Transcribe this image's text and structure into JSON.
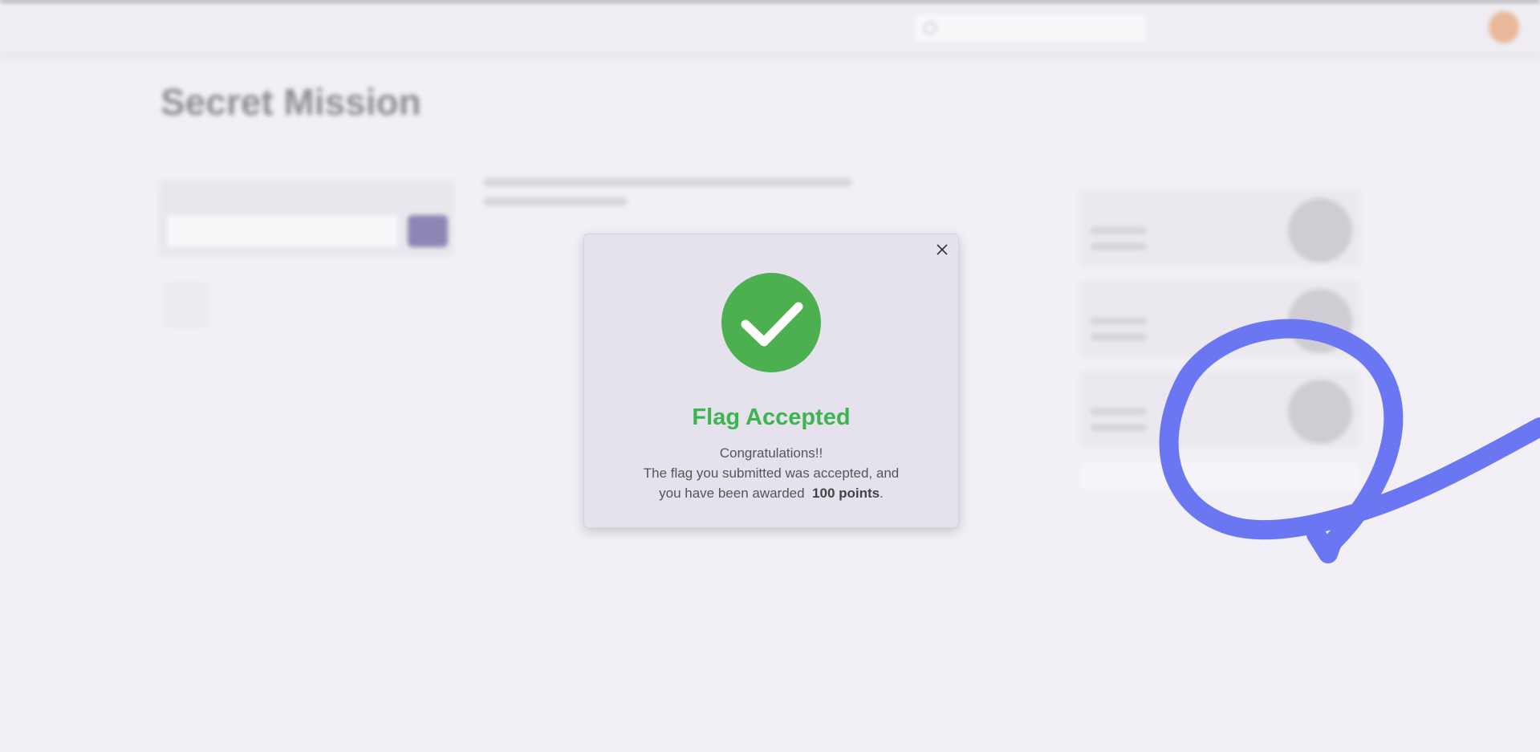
{
  "modal": {
    "title": "Flag Accepted",
    "line1": "Congratulations!!",
    "line2": "The flag you submitted was accepted, and",
    "line3_prefix": "you have been awarded",
    "points": "100 points",
    "line3_suffix": ".",
    "check_icon": "check-circle-icon",
    "close_icon": "close-icon",
    "success_color": "#4caf50"
  },
  "background": {
    "page_title": "Secret Mission"
  },
  "annotation": {
    "color": "#6b77f2"
  }
}
